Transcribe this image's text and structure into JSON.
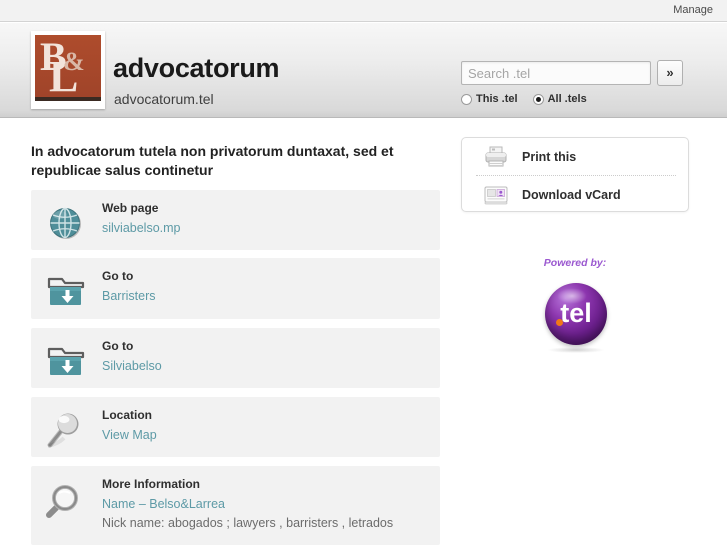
{
  "topbar": {
    "manage_label": "Manage"
  },
  "header": {
    "site_title": "advocatorum",
    "site_domain": "advocatorum.tel",
    "logo": {
      "letter_b": "B",
      "ampersand": "&",
      "letter_l": "L"
    },
    "search": {
      "placeholder": "Search .tel",
      "value": "",
      "submit_label": "»",
      "scope_this_label": "This .tel",
      "scope_all_label": "All .tels",
      "scope_selected": "All .tels"
    }
  },
  "main": {
    "page_heading": "In advocatorum tutela non privatorum duntaxat, sed et republicae salus continetur",
    "cards": [
      {
        "icon": "globe-icon",
        "label": "Web page",
        "value": "silviabelso.mp",
        "subvalue": ""
      },
      {
        "icon": "folder-download-icon",
        "label": "Go to",
        "value": "Barristers",
        "subvalue": ""
      },
      {
        "icon": "folder-download-icon",
        "label": "Go to",
        "value": "Silviabelso",
        "subvalue": ""
      },
      {
        "icon": "map-pin-icon",
        "label": "Location",
        "value": "View Map",
        "subvalue": ""
      },
      {
        "icon": "magnifier-icon",
        "label": "More Information",
        "value": "Name – Belso&Larrea",
        "subvalue": "Nick name: abogados ; lawyers , barristers , letrados"
      }
    ]
  },
  "sidebar": {
    "actions": [
      {
        "icon": "printer-icon",
        "label": "Print this"
      },
      {
        "icon": "vcard-icon",
        "label": "Download vCard"
      }
    ],
    "powered_by_label": "Powered by:",
    "badge_text": "tel"
  },
  "colors": {
    "link": "#5d9aa6",
    "logo_brand": "#a8472a",
    "badge_purple": "#6b1f8c",
    "badge_dot_orange": "#f07818",
    "powered_purple": "#9b59d0",
    "card_bg": "#f2f2f2"
  }
}
